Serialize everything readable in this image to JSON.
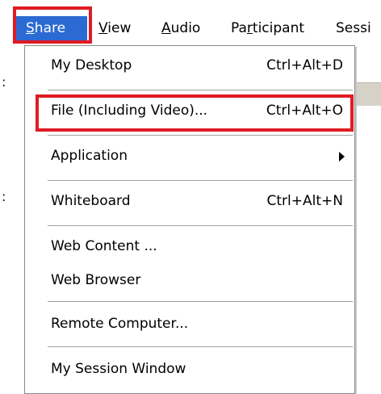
{
  "menubar": {
    "items": [
      {
        "label": "Share",
        "mnemonic_index": 0
      },
      {
        "label": "View",
        "mnemonic_index": 0
      },
      {
        "label": "Audio",
        "mnemonic_index": 0
      },
      {
        "label": "Participant",
        "mnemonic_index": 2
      },
      {
        "label": "Sessi"
      }
    ],
    "active_color": "#2b6ad3"
  },
  "menu": {
    "items": [
      {
        "label": "My Desktop",
        "shortcut": "Ctrl+Alt+D"
      },
      {
        "label": "File (Including Video)...",
        "shortcut": "Ctrl+Alt+O"
      },
      {
        "label": "Application",
        "submenu": true
      },
      {
        "label": "Whiteboard",
        "shortcut": "Ctrl+Alt+N"
      },
      {
        "label": "Web Content ..."
      },
      {
        "label": "Web Browser"
      },
      {
        "label": "Remote Computer..."
      },
      {
        "label": "My Session Window"
      }
    ]
  },
  "highlight_color": "#e01b24"
}
